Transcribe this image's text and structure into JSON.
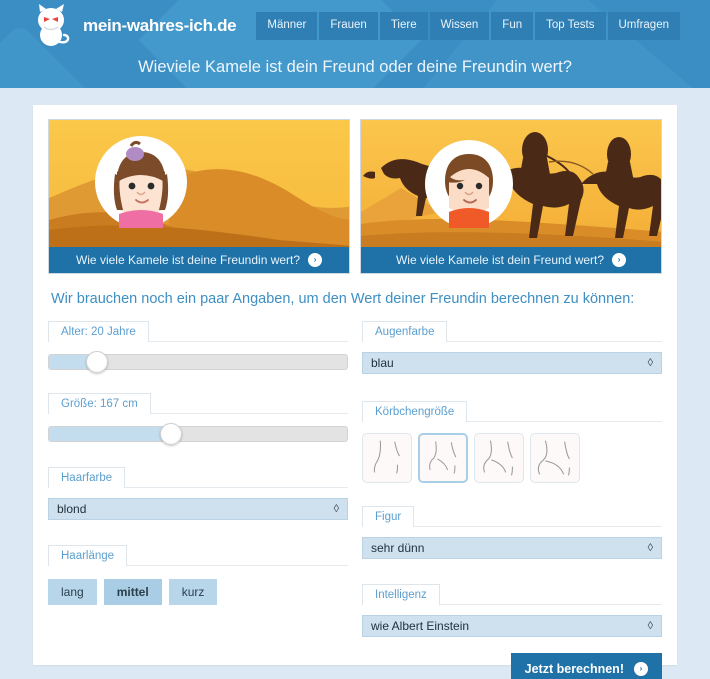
{
  "header": {
    "brand": "mein-wahres-ich.de",
    "logo_icon": "cat-mascot-icon",
    "nav": [
      {
        "label": "Männer"
      },
      {
        "label": "Frauen"
      },
      {
        "label": "Tiere"
      },
      {
        "label": "Wissen"
      },
      {
        "label": "Fun"
      },
      {
        "label": "Top Tests"
      },
      {
        "label": "Umfragen"
      }
    ],
    "title": "Wieviele Kamele ist dein Freund oder deine Freundin wert?",
    "colors": {
      "bar": "#3b8ec4",
      "nav_button": "#2f7fb4"
    }
  },
  "cards": [
    {
      "name": "girlfriend",
      "caption": "Wie viele Kamele ist deine Freundin wert?",
      "arrow": "›",
      "image_alt": "desert-dunes-with-girl-avatar"
    },
    {
      "name": "boyfriend",
      "caption": "Wie viele Kamele ist dein Freund wert?",
      "arrow": "›",
      "image_alt": "camel-caravan-with-boy-avatar"
    }
  ],
  "intro": "Wir brauchen noch ein paar Angaben, um den Wert deiner Freundin berechnen zu können:",
  "form": {
    "age": {
      "label": "Alter: 20 Jahre",
      "value": 20,
      "unit": "Jahre",
      "percent": 16
    },
    "height": {
      "label": "Größe: 167 cm",
      "value": 167,
      "unit": "cm",
      "percent": 41
    },
    "hair_color": {
      "label": "Haarfarbe",
      "value": "blond",
      "caret": "◊"
    },
    "hair_length": {
      "label": "Haarlänge",
      "options": [
        "lang",
        "mittel",
        "kurz"
      ],
      "selected_index": 1
    },
    "eye_color": {
      "label": "Augenfarbe",
      "value": "blau",
      "caret": "◊"
    },
    "cup_size": {
      "label": "Körbchengröße",
      "count": 4,
      "selected_index": 1
    },
    "figure": {
      "label": "Figur",
      "value": "sehr dünn",
      "caret": "◊"
    },
    "intelligence": {
      "label": "Intelligenz",
      "value": "wie Albert Einstein",
      "caret": "◊"
    },
    "submit": {
      "label": "Jetzt berechnen!",
      "arrow": "›"
    }
  }
}
